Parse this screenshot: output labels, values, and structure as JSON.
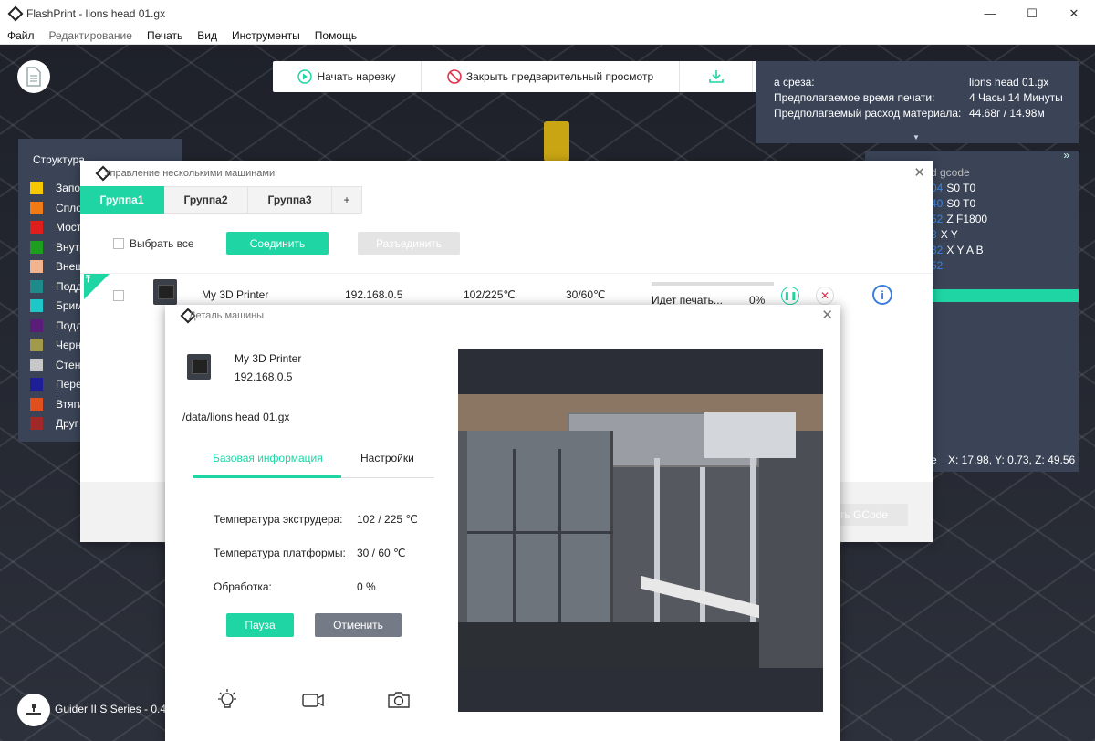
{
  "window": {
    "title": "FlashPrint - lions head 01.gx",
    "minimize": "—",
    "maximize": "☐",
    "close": "✕"
  },
  "menu": [
    "Файл",
    "Редактирование",
    "Печать",
    "Вид",
    "Инструменты",
    "Помощь"
  ],
  "toolbar": {
    "start_slice": "Начать нарезку",
    "close_preview": "Закрыть предварительный просмотр"
  },
  "slice_info": {
    "file_label": "а среза:",
    "file_value": "lions head 01.gx",
    "time_label": "Предполагаемое время печати:",
    "time_value": "4 Часы 14 Минуты",
    "material_label": "Предполагаемый расход материала:",
    "material_value": "44.68г / 14.98м"
  },
  "gcode_panel": {
    "toggle": "»",
    "title": "d gcode",
    "lines": [
      {
        "num": "04",
        "cmd": "S0 T0"
      },
      {
        "num": "40",
        "cmd": "S0 T0"
      },
      {
        "num": "52",
        "cmd": "Z F1800"
      },
      {
        "num": "3",
        "cmd": "X Y"
      },
      {
        "num": "32",
        "cmd": "X Y A B"
      },
      {
        "num": "52",
        "cmd": ""
      }
    ],
    "coords": "X: 17.98, Y: 0.73, Z: 49.56",
    "prefix": "е"
  },
  "structure": {
    "title": "Структура",
    "items": [
      {
        "label": "Запо",
        "color": "#f5c800"
      },
      {
        "label": "Спло",
        "color": "#f07a14"
      },
      {
        "label": "Мост",
        "color": "#e01e1e"
      },
      {
        "label": "Внутр",
        "color": "#1e9e1e"
      },
      {
        "label": "Внеш",
        "color": "#f2b48e"
      },
      {
        "label": "Подд",
        "color": "#1e8a8a"
      },
      {
        "label": "Брим",
        "color": "#1ec8c8"
      },
      {
        "label": "Подл",
        "color": "#5a1e78"
      },
      {
        "label": "Черн",
        "color": "#a09a4a"
      },
      {
        "label": "Стена",
        "color": "#c8c8c8"
      },
      {
        "label": "Пере",
        "color": "#1e1e96"
      },
      {
        "label": "Втяги",
        "color": "#e0501e"
      },
      {
        "label": "Друг",
        "color": "#a02828"
      }
    ]
  },
  "printer_status": {
    "label": "Guider II S Series - 0.4"
  },
  "multi": {
    "title": "Управление несколькими машинами",
    "tabs": [
      "Группа1",
      "Группа2",
      "Группа3",
      "+"
    ],
    "select_all": "Выбрать все",
    "connect": "Соединить",
    "disconnect": "Разъединить",
    "gcode_button": "ть GCode",
    "flag": "⤒",
    "row": {
      "name": "My 3D Printer",
      "ip": "192.168.0.5",
      "extruder": "102/225℃",
      "platform": "30/60℃",
      "status": "Идет печать...",
      "progress": "0%",
      "progress_value": 0
    }
  },
  "detail": {
    "title": "Деталь машины",
    "name": "My 3D Printer",
    "ip": "192.168.0.5",
    "path": "/data/lions head 01.gx",
    "tab_basic": "Базовая информация",
    "tab_settings": "Настройки",
    "extruder_label": "Температура экструдера:",
    "extruder_value": "102 / 225 ℃",
    "platform_label": "Температура платформы:",
    "platform_value": "30 / 60 ℃",
    "progress_label": "Обработка:",
    "progress_value": "0 %",
    "pause": "Пауза",
    "cancel": "Отменить"
  },
  "colors": {
    "accent": "#1ed5a3",
    "panel": "#3a4456",
    "viewport": "#2a2e38"
  }
}
